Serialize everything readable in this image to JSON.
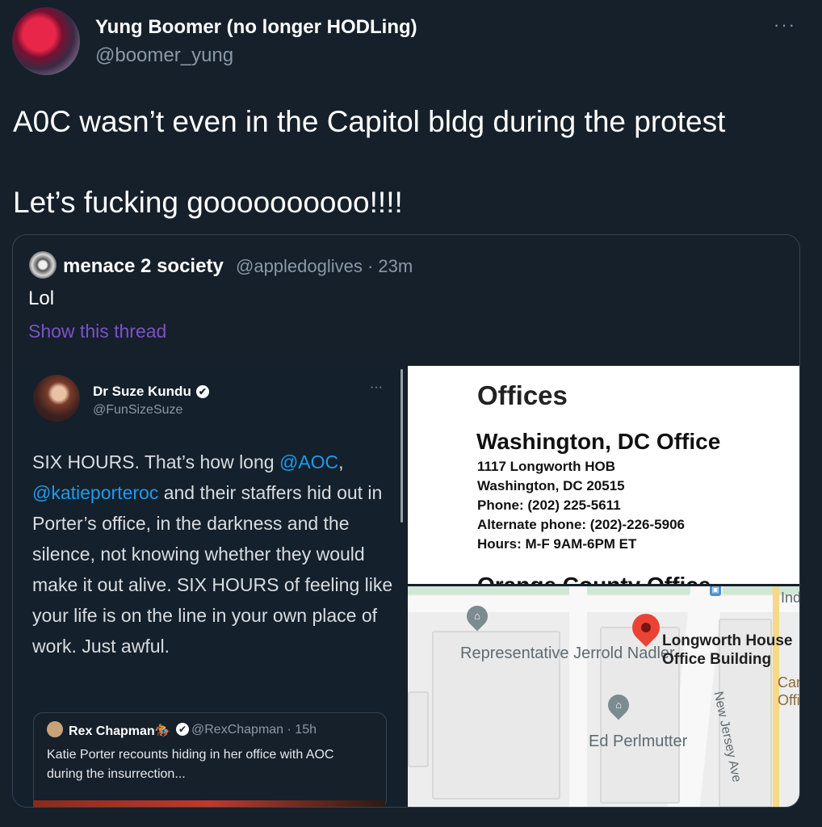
{
  "tweet": {
    "author_name": "Yung Boomer (no longer HODLing)",
    "author_handle": "@boomer_yung",
    "more": "···",
    "text_line1": "A0C wasn’t even in the Capitol bldg during the protest",
    "text_line2": "Let’s fucking goooooooooo!!!!"
  },
  "quote": {
    "author_name": "menace 2 society",
    "meta": "@appledoglives · 23m",
    "text": "Lol",
    "show_thread": "Show this thread"
  },
  "embedded_tweet": {
    "author_name": "Dr Suze Kundu",
    "author_handle": "@FunSizeSuze",
    "verified": "✔",
    "more": "···",
    "body_part1": "SIX HOURS. That’s how long ",
    "mention1": "@AOC",
    "body_part2": ",",
    "mention2": "@katieporteroc",
    "body_part3": " and their staffers hid out in Porter’s office, in the darkness and the silence, not knowing whether they would make it out alive. SIX HOURS of feeling like your life is on the line in your own place of work. Just awful.",
    "inner": {
      "author_name": "Rex Chapman🏇",
      "verified": "✔",
      "meta": "@RexChapman · 15h",
      "text": "Katie Porter recounts hiding in her office with AOC during the insurrection..."
    }
  },
  "offices": {
    "title": "Offices",
    "dc_heading": "Washington, DC Office",
    "lines": [
      "1117 Longworth HOB",
      "Washington, DC 20515",
      "Phone: (202) 225-5611",
      "Alternate phone: (202)-226-5906",
      "Hours: M-F 9AM-6PM ET"
    ],
    "clipped_heading": "Orange County Office"
  },
  "map": {
    "label_nadler": "Representative Jerrold Nadler",
    "label_longworth": "Longworth House Office Building",
    "label_perlmutter": "Ed Perlmutter",
    "label_street": "New Jersey Ave",
    "label_ind": "Ind",
    "label_can": "Can Offi",
    "colors": {
      "pin_red": "#ea4335",
      "pin_grey": "#7b8b90"
    }
  },
  "colors": {
    "background": "#15202b",
    "link_blue": "#1d9bf0",
    "thread_purple": "#7b52c7",
    "secondary_text": "#8b98a5"
  }
}
